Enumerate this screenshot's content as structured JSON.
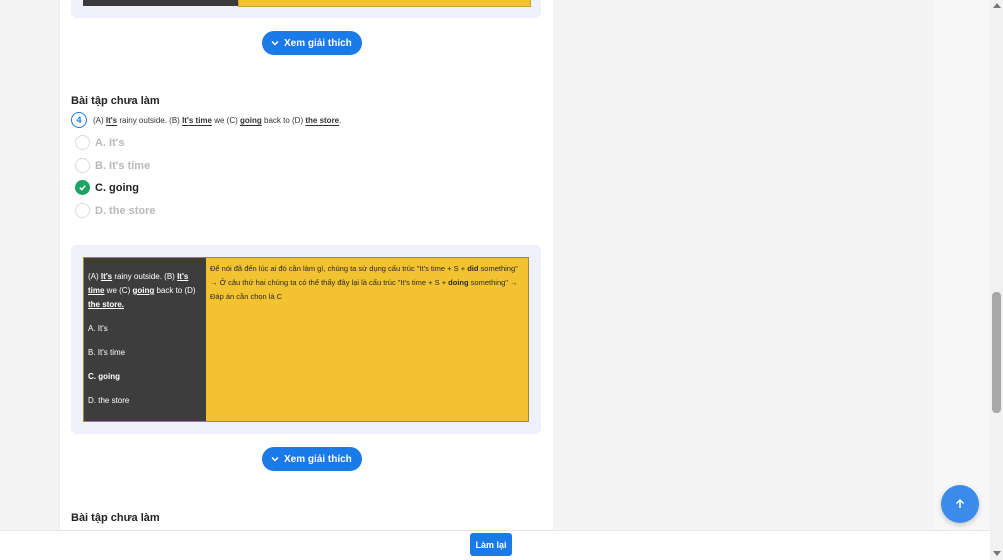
{
  "explain_button_label": "Xem giải thích",
  "section_title": "Bài tập chưa làm",
  "question": {
    "number": "4",
    "parts": {
      "a_prefix": "(A) ",
      "a": "It's",
      "mid1": " rainy outside. (B) ",
      "b": "It's time",
      "mid2": " we (C) ",
      "c": "going",
      "mid3": " back to (D) ",
      "d": "the store",
      "end": "."
    }
  },
  "options": [
    {
      "label": "A. It's"
    },
    {
      "label": "B. It's time"
    },
    {
      "label": "C. going"
    },
    {
      "label": "D. the store"
    }
  ],
  "explanation": {
    "left": {
      "l1a": "(A) ",
      "l1b": "It's",
      "l1c": " rainy outside. (B) ",
      "l1d": "It's time",
      "l1e": " we (C) ",
      "l1f": "going",
      "l1g": " back to (D) ",
      "l1h": "the store.",
      "optA": "A. It's",
      "optB": "B. It's time",
      "optC": "C. going",
      "optD": "D. the store"
    },
    "right": {
      "t1": "Để nói đã đến lúc ai đó cần làm gì, chúng ta sử dụng cấu trúc \"It's time + S + ",
      "t2": "did",
      "t3": " something\" → Ở câu thứ hai chúng ta có thể thấy đây lại là cấu trúc \"It's time + S + ",
      "t4": "doing",
      "t5": " something\" → Đáp án cần chọn là C"
    }
  },
  "redo_label": "Làm lại",
  "colors": {
    "primary": "#1a7ae8",
    "correct": "#1fa463",
    "explain_bg": "#f2c230",
    "dark_cell": "#3d3d3d"
  },
  "icons": [
    "chevron-down-icon",
    "check-icon",
    "arrow-up-icon"
  ]
}
